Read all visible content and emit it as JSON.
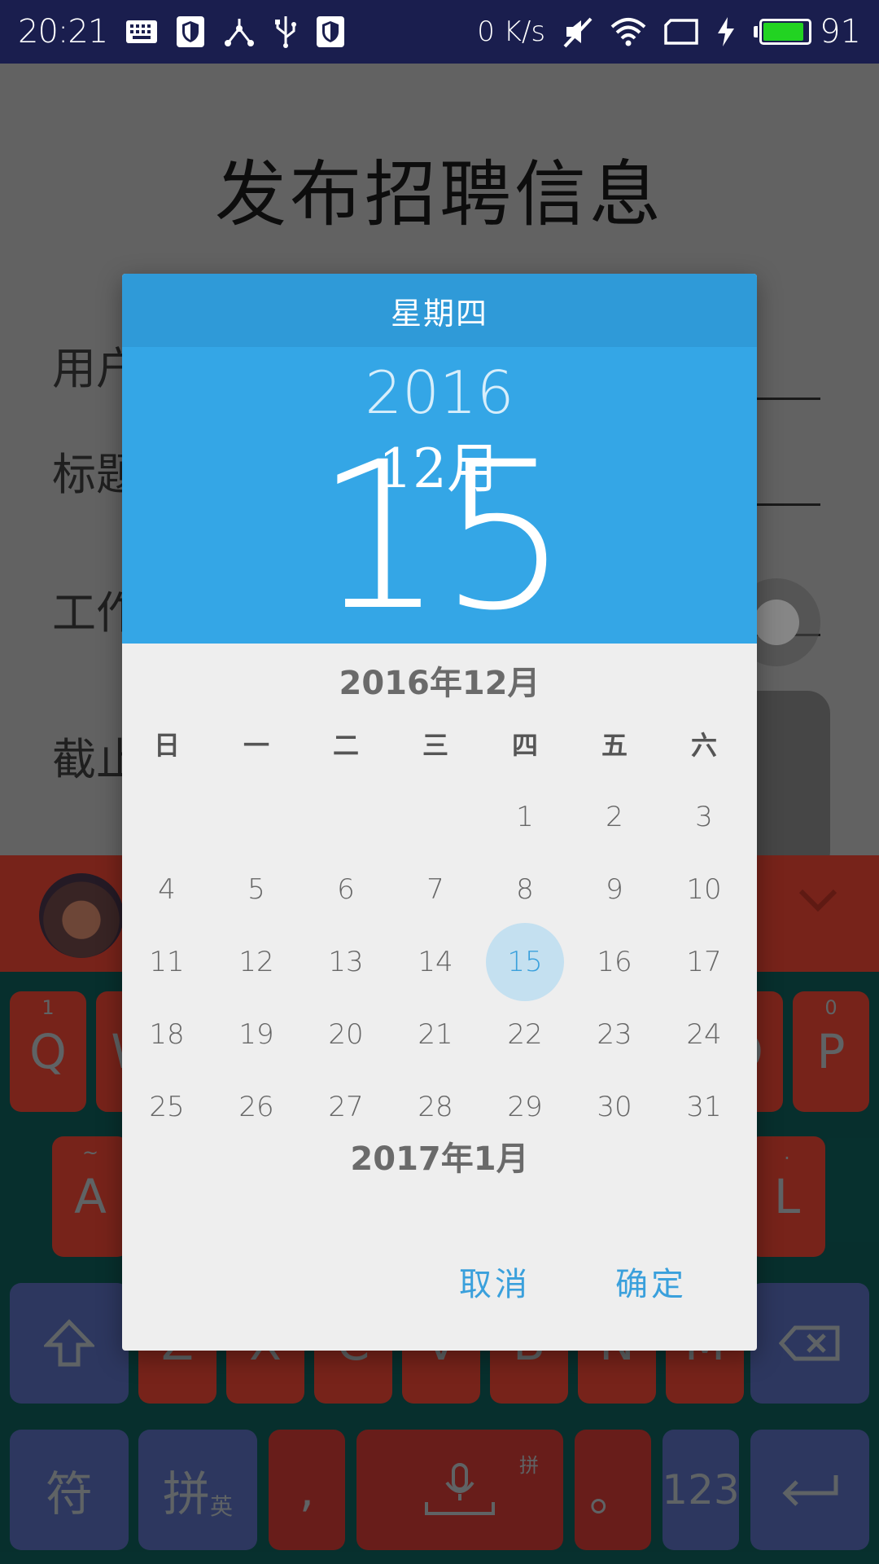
{
  "status_bar": {
    "time": "20:21",
    "net_speed": "0 K/s",
    "battery": "91",
    "battery_level": 0.91,
    "icons": [
      "keyboard-icon",
      "shield-icon",
      "share-node-icon",
      "usb-icon",
      "shield-icon",
      "mute-icon",
      "wifi-icon",
      "screen-rotate-icon",
      "charging-icon",
      "battery-icon"
    ]
  },
  "form": {
    "title": "发布招聘信息",
    "labels": [
      "用户",
      "标题",
      "工作",
      "截止"
    ]
  },
  "keyboard": {
    "avatar": "avatar",
    "collapse_icon": "chevron-down-icon",
    "row1": [
      {
        "label": "Q",
        "sub": "1"
      },
      {
        "label": "W",
        "sub": ""
      },
      {
        "label": "O",
        "sub": ""
      },
      {
        "label": "P",
        "sub": "0"
      }
    ],
    "row2": [
      {
        "label": "A",
        "sub": "~"
      },
      {
        "label": "L",
        "sub": "."
      }
    ],
    "row3": [
      "Z",
      "X",
      "C",
      "V",
      "B",
      "N",
      "M"
    ],
    "row4": {
      "symbols": "符",
      "pinyin": "拼",
      "pinyin_sub": "英",
      "comma": ",",
      "mic_sub": "拼",
      "period": "。",
      "num": "123"
    }
  },
  "dialog": {
    "weekday": "星期四",
    "year": "2016",
    "month": "12月",
    "day": "15",
    "calendar_month": "2016年12月",
    "next_month": "2017年1月",
    "weekdays": [
      "日",
      "一",
      "二",
      "三",
      "四",
      "五",
      "六"
    ],
    "weeks": [
      [
        "",
        "",
        "",
        "",
        "1",
        "2",
        "3"
      ],
      [
        "4",
        "5",
        "6",
        "7",
        "8",
        "9",
        "10"
      ],
      [
        "11",
        "12",
        "13",
        "14",
        "15",
        "16",
        "17"
      ],
      [
        "18",
        "19",
        "20",
        "21",
        "22",
        "23",
        "24"
      ],
      [
        "25",
        "26",
        "27",
        "28",
        "29",
        "30",
        "31"
      ]
    ],
    "selected_day": "15",
    "cancel": "取消",
    "confirm": "确定",
    "accent_color": "#34a6e6"
  }
}
